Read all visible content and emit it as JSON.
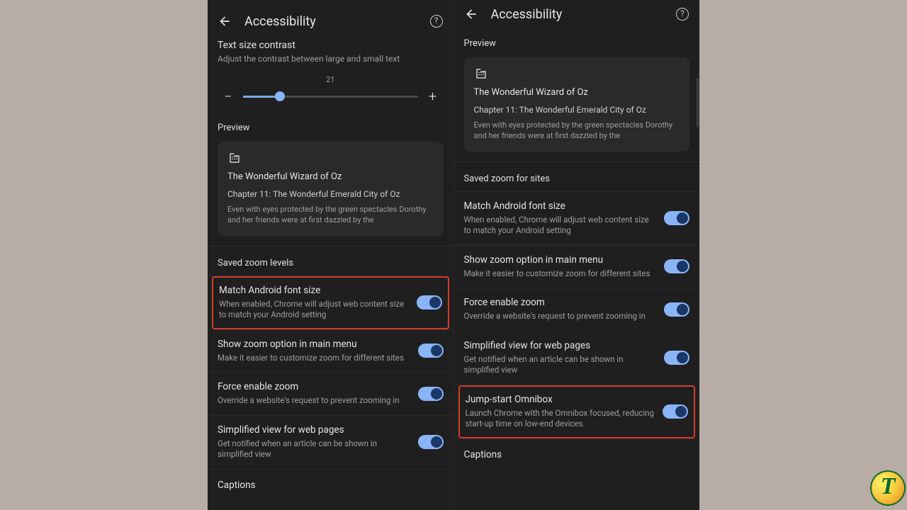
{
  "header": {
    "title": "Accessibility"
  },
  "contrast": {
    "title": "Text size contrast",
    "subtitle": "Adjust the contrast between large and small text",
    "value": "21"
  },
  "preview": {
    "label": "Preview",
    "title": "The Wonderful Wizard of Oz",
    "chapter": "Chapter 11: The Wonderful Emerald City of Oz",
    "body": "Even with eyes protected by the green spectacles Dorothy and her friends were at first dazzled by the"
  },
  "left": {
    "saved_label": "Saved zoom levels",
    "items": [
      {
        "title": "Match Android font size",
        "sub": "When enabled, Chrome will adjust web content size to match your Android setting"
      },
      {
        "title": "Show zoom option in main menu",
        "sub": "Make it easier to customize zoom for different sites"
      },
      {
        "title": "Force enable zoom",
        "sub": "Override a website's request to prevent zooming in"
      },
      {
        "title": "Simplified view for web pages",
        "sub": "Get notified when an article can be shown in simplified view"
      }
    ],
    "captions": "Captions"
  },
  "right": {
    "saved_label": "Saved zoom for sites",
    "items": [
      {
        "title": "Match Android font size",
        "sub": "When enabled, Chrome will adjust web content size to match your Android setting"
      },
      {
        "title": "Show zoom option in main menu",
        "sub": "Make it easier to customize zoom for different sites"
      },
      {
        "title": "Force enable zoom",
        "sub": "Override a website's request to prevent zooming in"
      },
      {
        "title": "Simplified view for web pages",
        "sub": "Get notified when an article can be shown in simplified view"
      },
      {
        "title": "Jump-start Omnibox",
        "sub": "Launch Chrome with the Omnibox focused, reducing start-up time on low-end devices."
      }
    ],
    "captions": "Captions"
  },
  "watermark": "T"
}
